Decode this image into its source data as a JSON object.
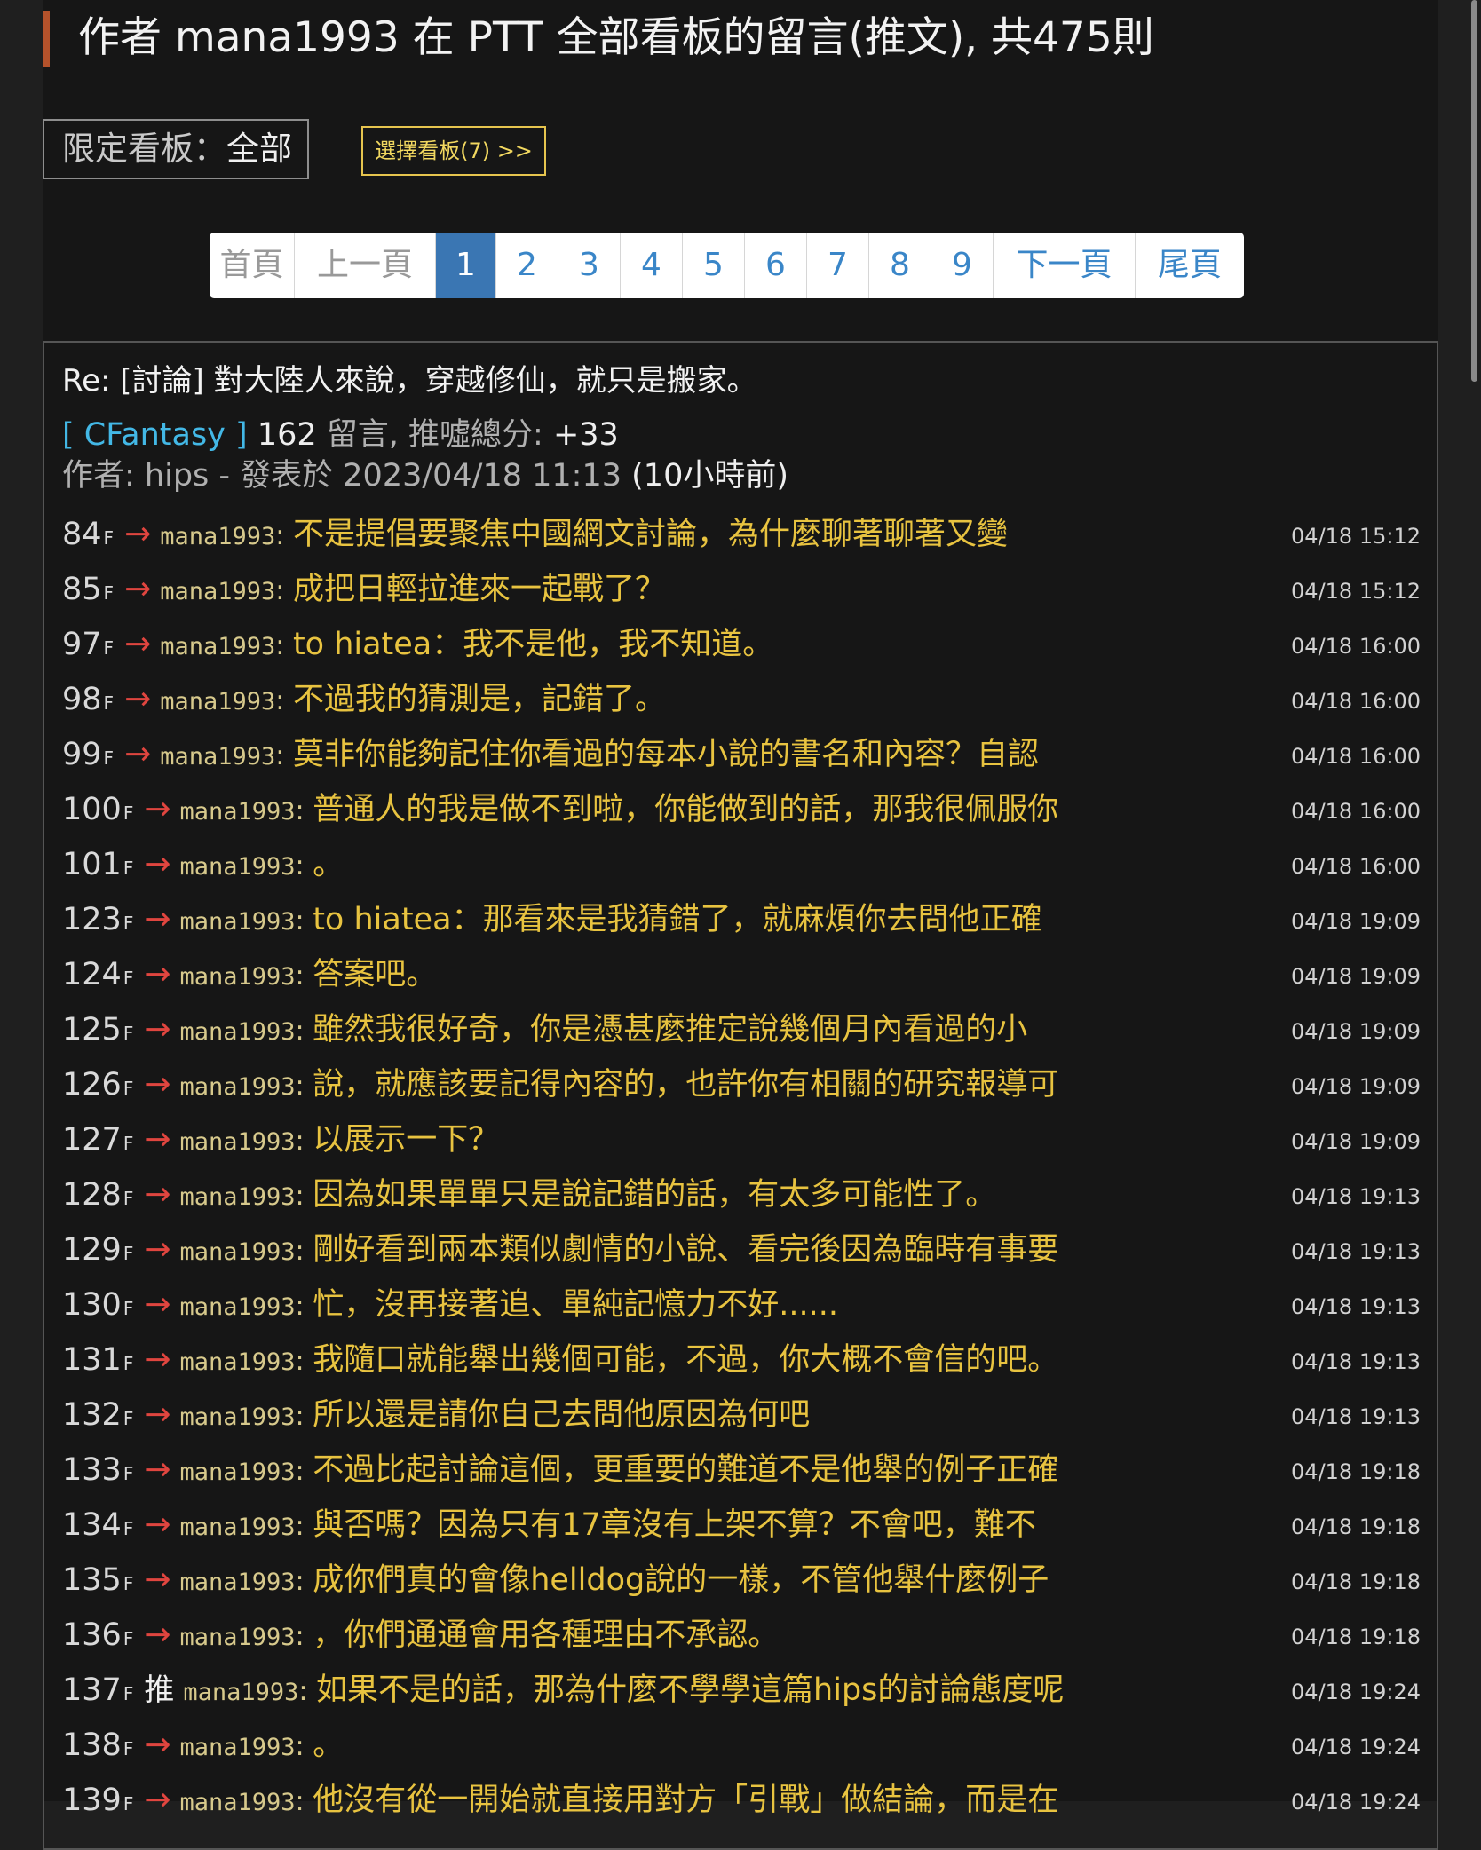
{
  "header": {
    "title": "作者 mana1993 在 PTT 全部看板的留言(推文), 共475則"
  },
  "filter": {
    "label": "限定看板：",
    "value": "全部",
    "select_button": "選擇看板(7) >>"
  },
  "pagination": {
    "first": "首頁",
    "prev": "上一頁",
    "pages": [
      "1",
      "2",
      "3",
      "4",
      "5",
      "6",
      "7",
      "8",
      "9"
    ],
    "current": "1",
    "next": "下一頁",
    "last": "尾頁"
  },
  "post": {
    "title": "Re: [討論] 對大陸人來說，穿越修仙，就只是搬家。",
    "board": "[ CFantasy ]",
    "comment_count": "162",
    "comment_label": "留言, 推噓總分:",
    "score": "+33",
    "author_line": "作者: hips - 發表於 2023/04/18 11:13",
    "ago": "(10小時前)"
  },
  "comments": [
    {
      "floor": "84",
      "tag": "→",
      "user": "mana1993",
      "text": "不是提倡要聚焦中國網文討論，為什麼聊著聊著又變",
      "time": "04/18 15:12"
    },
    {
      "floor": "85",
      "tag": "→",
      "user": "mana1993",
      "text": "成把日輕拉進來一起戰了？",
      "time": "04/18 15:12"
    },
    {
      "floor": "97",
      "tag": "→",
      "user": "mana1993",
      "text": "to hiatea：我不是他，我不知道。",
      "time": "04/18 16:00"
    },
    {
      "floor": "98",
      "tag": "→",
      "user": "mana1993",
      "text": "不過我的猜測是，記錯了。",
      "time": "04/18 16:00"
    },
    {
      "floor": "99",
      "tag": "→",
      "user": "mana1993",
      "text": "莫非你能夠記住你看過的每本小說的書名和內容？自認",
      "time": "04/18 16:00"
    },
    {
      "floor": "100",
      "tag": "→",
      "user": "mana1993",
      "text": "普通人的我是做不到啦，你能做到的話，那我很佩服你",
      "time": "04/18 16:00"
    },
    {
      "floor": "101",
      "tag": "→",
      "user": "mana1993",
      "text": "。",
      "time": "04/18 16:00"
    },
    {
      "floor": "123",
      "tag": "→",
      "user": "mana1993",
      "text": "to hiatea：那看來是我猜錯了，就麻煩你去問他正確",
      "time": "04/18 19:09"
    },
    {
      "floor": "124",
      "tag": "→",
      "user": "mana1993",
      "text": "答案吧。",
      "time": "04/18 19:09"
    },
    {
      "floor": "125",
      "tag": "→",
      "user": "mana1993",
      "text": "雖然我很好奇，你是憑甚麼推定說幾個月內看過的小",
      "time": "04/18 19:09"
    },
    {
      "floor": "126",
      "tag": "→",
      "user": "mana1993",
      "text": "說，就應該要記得內容的，也許你有相關的研究報導可",
      "time": "04/18 19:09"
    },
    {
      "floor": "127",
      "tag": "→",
      "user": "mana1993",
      "text": "以展示一下？",
      "time": "04/18 19:09"
    },
    {
      "floor": "128",
      "tag": "→",
      "user": "mana1993",
      "text": "因為如果單單只是說記錯的話，有太多可能性了。",
      "time": "04/18 19:13"
    },
    {
      "floor": "129",
      "tag": "→",
      "user": "mana1993",
      "text": "剛好看到兩本類似劇情的小說、看完後因為臨時有事要",
      "time": "04/18 19:13"
    },
    {
      "floor": "130",
      "tag": "→",
      "user": "mana1993",
      "text": "忙，沒再接著追、單純記憶力不好......",
      "time": "04/18 19:13"
    },
    {
      "floor": "131",
      "tag": "→",
      "user": "mana1993",
      "text": "我隨口就能舉出幾個可能，不過，你大概不會信的吧。",
      "time": "04/18 19:13"
    },
    {
      "floor": "132",
      "tag": "→",
      "user": "mana1993",
      "text": "所以還是請你自己去問他原因為何吧",
      "time": "04/18 19:13"
    },
    {
      "floor": "133",
      "tag": "→",
      "user": "mana1993",
      "text": "不過比起討論這個，更重要的難道不是他舉的例子正確",
      "time": "04/18 19:18"
    },
    {
      "floor": "134",
      "tag": "→",
      "user": "mana1993",
      "text": "與否嗎？因為只有17章沒有上架不算？不會吧，難不",
      "time": "04/18 19:18"
    },
    {
      "floor": "135",
      "tag": "→",
      "user": "mana1993",
      "text": "成你們真的會像helldog說的一樣，不管他舉什麼例子",
      "time": "04/18 19:18"
    },
    {
      "floor": "136",
      "tag": "→",
      "user": "mana1993",
      "text": "，你們通通會用各種理由不承認。",
      "time": "04/18 19:18"
    },
    {
      "floor": "137",
      "tag": "推",
      "user": "mana1993",
      "text": "如果不是的話，那為什麼不學學這篇hips的討論態度呢",
      "time": "04/18 19:24"
    },
    {
      "floor": "138",
      "tag": "→",
      "user": "mana1993",
      "text": "。",
      "time": "04/18 19:24"
    },
    {
      "floor": "139",
      "tag": "→",
      "user": "mana1993",
      "text": "他沒有從一開始就直接用對方「引戰」做結論，而是在",
      "time": "04/18 19:24"
    }
  ]
}
